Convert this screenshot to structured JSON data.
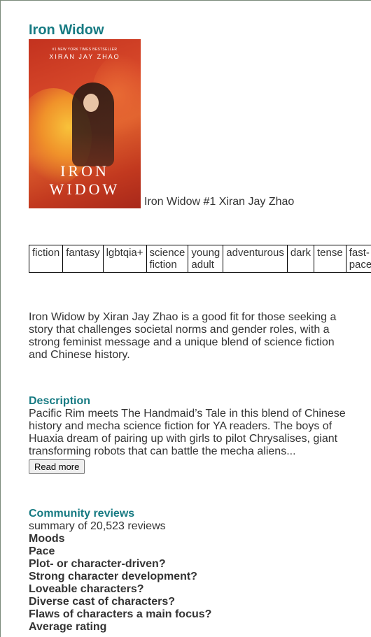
{
  "book": {
    "title": "Iron Widow",
    "cover": {
      "bestseller_text": "#1 NEW YORK TIMES BESTSELLER",
      "author_text": "XIRAN JAY ZHAO",
      "title_line1": "IRON",
      "title_line2": "WIDOW"
    },
    "caption": "Iron Widow #1 Xiran Jay Zhao"
  },
  "tags": [
    "fiction",
    "fantasy",
    "lgbtqia+",
    "science fiction",
    "young adult",
    "adventurous",
    "dark",
    "tense",
    "fast-paced"
  ],
  "summary": "Iron Widow by Xiran Jay Zhao is a good fit for those seeking a story that challenges societal norms and gender roles, with a strong feminist message and a unique blend of science fiction and Chinese history.",
  "description": {
    "heading": "Description",
    "text": "Pacific Rim meets The Handmaid’s Tale in this blend of Chinese history and mecha science fiction for YA readers. The boys of Huaxia dream of pairing up with girls to pilot Chrysalises, giant transforming robots that can battle the mecha aliens...",
    "read_more_label": "Read more"
  },
  "community_reviews": {
    "heading": "Community reviews",
    "summary": "summary of 20,523 reviews",
    "labels": [
      "Moods",
      "Pace",
      "Plot- or character-driven?",
      "Strong character development?",
      "Loveable characters?",
      "Diverse cast of characters?",
      "Flaws of characters a main focus?",
      "Average rating"
    ]
  },
  "colors": {
    "heading_accent": "#167a82",
    "text": "#333333"
  }
}
